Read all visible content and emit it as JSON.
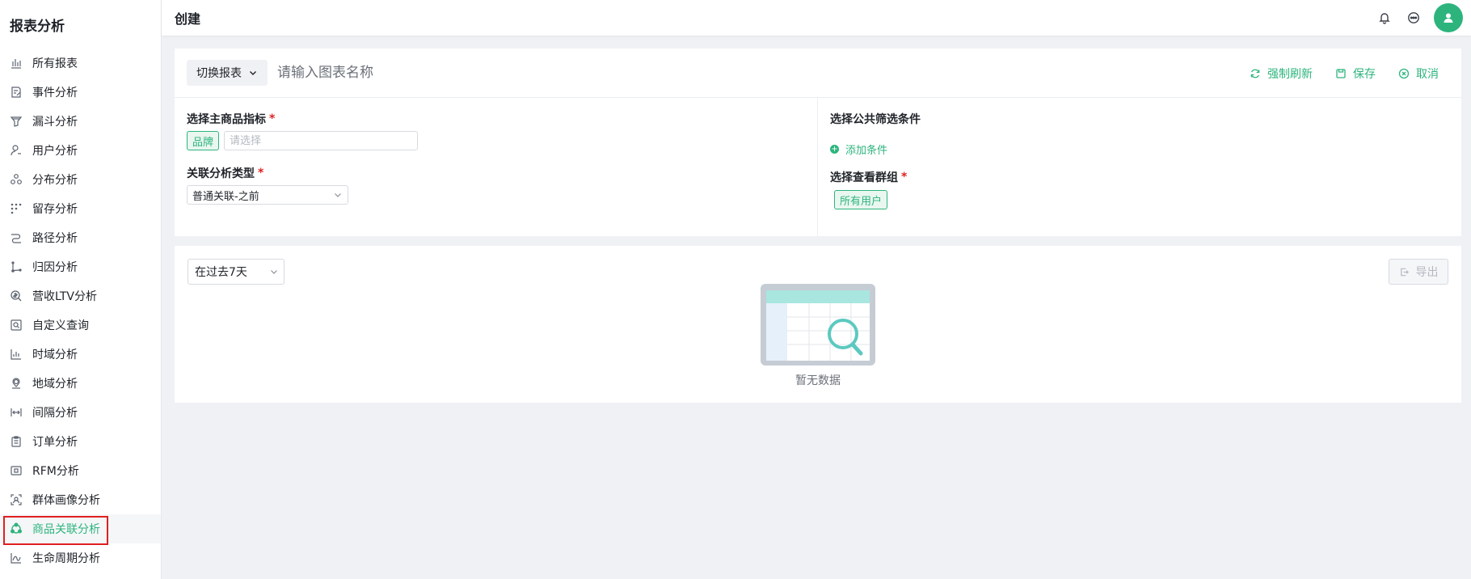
{
  "sidebar": {
    "title": "报表分析",
    "items": [
      {
        "label": "所有报表",
        "icon": "bar-chart-icon"
      },
      {
        "label": "事件分析",
        "icon": "edit-note-icon"
      },
      {
        "label": "漏斗分析",
        "icon": "funnel-icon"
      },
      {
        "label": "用户分析",
        "icon": "user-icon"
      },
      {
        "label": "分布分析",
        "icon": "distribution-icon"
      },
      {
        "label": "留存分析",
        "icon": "retention-icon"
      },
      {
        "label": "路径分析",
        "icon": "path-icon"
      },
      {
        "label": "归因分析",
        "icon": "attribution-icon"
      },
      {
        "label": "营收LTV分析",
        "icon": "revenue-icon"
      },
      {
        "label": "自定义查询",
        "icon": "custom-query-icon"
      },
      {
        "label": "时域分析",
        "icon": "time-chart-icon"
      },
      {
        "label": "地域分析",
        "icon": "location-icon"
      },
      {
        "label": "间隔分析",
        "icon": "interval-icon"
      },
      {
        "label": "订单分析",
        "icon": "clipboard-icon"
      },
      {
        "label": "RFM分析",
        "icon": "rfm-icon"
      },
      {
        "label": "群体画像分析",
        "icon": "portrait-icon"
      },
      {
        "label": "商品关联分析",
        "icon": "product-association-icon",
        "active": true
      },
      {
        "label": "生命周期分析",
        "icon": "lifecycle-icon"
      }
    ]
  },
  "header": {
    "title": "创建",
    "icons": [
      "bell-icon",
      "message-icon",
      "user-avatar-icon"
    ]
  },
  "config": {
    "switch_label": "切换报表",
    "name_placeholder": "请输入图表名称",
    "actions": {
      "refresh": "强制刷新",
      "save": "保存",
      "cancel": "取消"
    },
    "main_indicator_label": "选择主商品指标",
    "main_indicator_tag": "品牌",
    "main_indicator_placeholder": "请选择",
    "analysis_type_label": "关联分析类型",
    "analysis_type_value": "普通关联-之前",
    "filter_label": "选择公共筛选条件",
    "add_condition": "添加条件",
    "group_label": "选择查看群组",
    "group_tag": "所有用户",
    "required_mark": "*"
  },
  "result": {
    "range_value": "在过去7天",
    "export_label": "导出",
    "empty_text": "暂无数据"
  },
  "colors": {
    "accent": "#2db47d",
    "required": "#e02020",
    "highlight_box": "#e02020"
  }
}
